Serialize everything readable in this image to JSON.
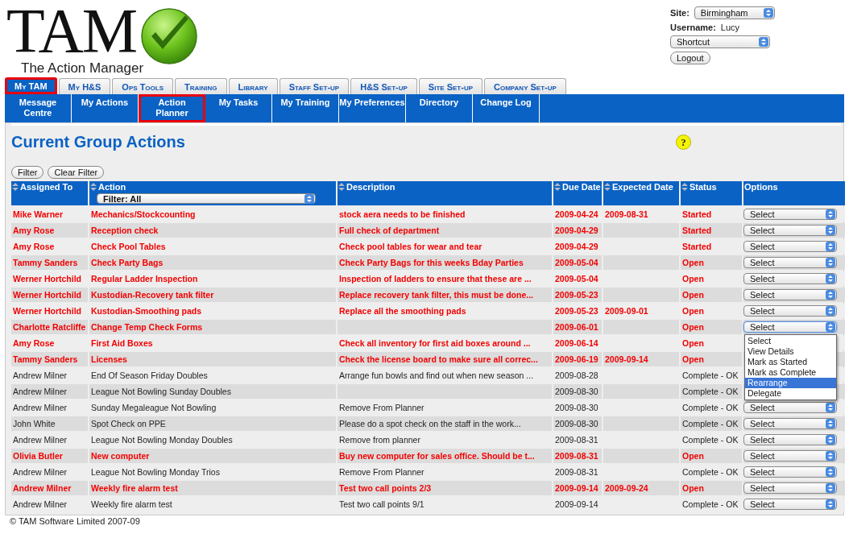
{
  "header": {
    "logo": {
      "title": "TAM",
      "subtitle": "The Action Manager"
    },
    "site": {
      "label": "Site:",
      "value": "Birmingham"
    },
    "username": {
      "label": "Username:",
      "value": "Lucy"
    },
    "shortcut": {
      "value": "Shortcut"
    },
    "logout": "Logout"
  },
  "tabs": [
    {
      "label": "My TAM",
      "selected": true,
      "highlighted": true
    },
    {
      "label": "My H&S",
      "selected": false,
      "highlighted": false
    },
    {
      "label": "Ops Tools",
      "selected": false,
      "highlighted": false
    },
    {
      "label": "Training",
      "selected": false,
      "highlighted": false
    },
    {
      "label": "Library",
      "selected": false,
      "highlighted": false
    },
    {
      "label": "Staff Set-up",
      "selected": false,
      "highlighted": false
    },
    {
      "label": "H&S Set-up",
      "selected": false,
      "highlighted": false
    },
    {
      "label": "Site Set-up",
      "selected": false,
      "highlighted": false
    },
    {
      "label": "Company Set-up",
      "selected": false,
      "highlighted": false
    }
  ],
  "nav": [
    {
      "label": "Message Centre",
      "highlighted": false
    },
    {
      "label": "My Actions",
      "highlighted": false
    },
    {
      "label": "Action Planner",
      "highlighted": true
    },
    {
      "label": "My Tasks",
      "highlighted": false
    },
    {
      "label": "My Training",
      "highlighted": false
    },
    {
      "label": "My Preferences",
      "highlighted": false
    },
    {
      "label": "Directory",
      "highlighted": false
    },
    {
      "label": "Change Log",
      "highlighted": false
    }
  ],
  "page": {
    "title": "Current Group Actions",
    "help": "?",
    "buttons": [
      "Filter",
      "Clear Filter"
    ]
  },
  "table": {
    "columns": [
      {
        "label": "Assigned To",
        "sortable": true
      },
      {
        "label": "Action",
        "sortable": true
      },
      {
        "label": "Description",
        "sortable": true
      },
      {
        "label": "Due Date",
        "sortable": true
      },
      {
        "label": "Expected Date",
        "sortable": true
      },
      {
        "label": "Status",
        "sortable": true
      },
      {
        "label": "Options",
        "sortable": false
      }
    ],
    "action_filter": "Filter: All",
    "rows": [
      {
        "assigned_to": "Mike Warner",
        "action": "Mechanics/Stockcounting",
        "description": "stock aera needs to be finished",
        "due_date": "2009-04-24",
        "expected_date": "2009-08-31",
        "status": "Started",
        "highlighted": true,
        "option": "Select",
        "open": false
      },
      {
        "assigned_to": "Amy Rose",
        "action": "Reception check",
        "description": "Full check of department",
        "due_date": "2009-04-29",
        "status": "Started",
        "highlighted": true,
        "option": "Select",
        "open": false
      },
      {
        "assigned_to": "Amy Rose",
        "action": "Check Pool Tables",
        "description": "Check pool tables for wear and tear",
        "due_date": "2009-04-29",
        "status": "Started",
        "highlighted": true,
        "option": "Select",
        "open": false
      },
      {
        "assigned_to": "Tammy Sanders",
        "action": "Check Party Bags",
        "description": "Check Party Bags for this weeks Bday Parties",
        "due_date": "2009-05-04",
        "status": "Open",
        "highlighted": true,
        "option": "Select",
        "open": false
      },
      {
        "assigned_to": "Werner Hortchild",
        "action": "Regular Ladder Inspection",
        "description": "Inspection of ladders to ensure that these are ...",
        "due_date": "2009-05-04",
        "status": "Open",
        "highlighted": true,
        "option": "Select",
        "open": false
      },
      {
        "assigned_to": "Werner Hortchild",
        "action": "Kustodian-Recovery tank filter",
        "description": "Replace recovery tank filter, this must be done...",
        "due_date": "2009-05-23",
        "status": "Open",
        "highlighted": true,
        "option": "Select",
        "open": false
      },
      {
        "assigned_to": "Werner Hortchild",
        "action": "Kustodian-Smoothing pads",
        "description": "Replace all the smoothing pads",
        "due_date": "2009-05-23",
        "expected_date": "2009-09-01",
        "status": "Open",
        "highlighted": true,
        "option": "Select",
        "open": false
      },
      {
        "assigned_to": "Charlotte Ratcliffe",
        "action": "Change Temp Check Forms",
        "due_date": "2009-06-01",
        "status": "Open",
        "highlighted": true,
        "option": "Select",
        "open": true
      },
      {
        "assigned_to": "Amy Rose",
        "action": "First Aid Boxes",
        "description": "Check all inventory for first aid boxes around ...",
        "due_date": "2009-06-14",
        "status": "Open",
        "highlighted": true
      },
      {
        "assigned_to": "Tammy Sanders",
        "action": "Licenses",
        "description": "Check the license board to make sure all correc...",
        "due_date": "2009-06-19",
        "expected_date": "2009-09-14",
        "status": "Open",
        "highlighted": true
      },
      {
        "assigned_to": "Andrew Milner",
        "action": "End Of Season Friday Doubles",
        "description": "Arrange fun bowls and find out when new season ...",
        "due_date": "2009-08-28",
        "status": "Complete - OK",
        "highlighted": false
      },
      {
        "assigned_to": "Andrew Milner",
        "action": "League Not Bowling Sunday Doubles",
        "due_date": "2009-08-30",
        "status": "Complete - OK",
        "highlighted": false
      },
      {
        "assigned_to": "Andrew Milner",
        "action": "Sunday Megaleague Not Bowling",
        "description": "Remove From Planner",
        "due_date": "2009-08-30",
        "status": "Complete - OK",
        "highlighted": false,
        "option": "Select",
        "open": false
      },
      {
        "assigned_to": "John White",
        "action": "Spot Check on PPE",
        "description": "Please do a spot check on the staff in the work...",
        "due_date": "2009-08-30",
        "status": "Complete - OK",
        "highlighted": false,
        "option": "Select",
        "open": false
      },
      {
        "assigned_to": "Andrew Milner",
        "action": "League Not Bowling Monday Doubles",
        "description": "Remove from planner",
        "due_date": "2009-08-31",
        "status": "Complete - OK",
        "highlighted": false,
        "option": "Select",
        "open": false
      },
      {
        "assigned_to": "Olivia Butler",
        "action": "New computer",
        "description": "Buy new computer for sales office. Should be t...",
        "due_date": "2009-08-31",
        "status": "Open",
        "highlighted": true,
        "option": "Select",
        "open": false
      },
      {
        "assigned_to": "Andrew Milner",
        "action": "League Not Bowling Monday Trios",
        "description": "Remove From Planner",
        "due_date": "2009-08-31",
        "status": "Complete - OK",
        "highlighted": false,
        "option": "Select",
        "open": false
      },
      {
        "assigned_to": "Andrew Milner",
        "action": "Weekly fire alarm test",
        "description": "Test two call points 2/3",
        "due_date": "2009-09-14",
        "expected_date": "2009-09-24",
        "status": "Open",
        "highlighted": true,
        "option": "Select",
        "open": false
      },
      {
        "assigned_to": "Andrew Milner",
        "action": "Weekly fire alarm test",
        "description": "Test two call points 9/1",
        "due_date": "2009-09-14",
        "status": "Complete - OK",
        "highlighted": false,
        "option": "Select",
        "open": false
      }
    ]
  },
  "options_menu": {
    "items": [
      {
        "label": "Select",
        "selected": false
      },
      {
        "label": "View Details",
        "selected": false
      },
      {
        "label": "Mark as Started",
        "selected": false
      },
      {
        "label": "Mark as Complete",
        "selected": false
      },
      {
        "label": "Rearrange",
        "selected": true
      },
      {
        "label": "Delegate",
        "selected": false
      }
    ]
  },
  "footer": "© TAM Software Limited 2007-09"
}
